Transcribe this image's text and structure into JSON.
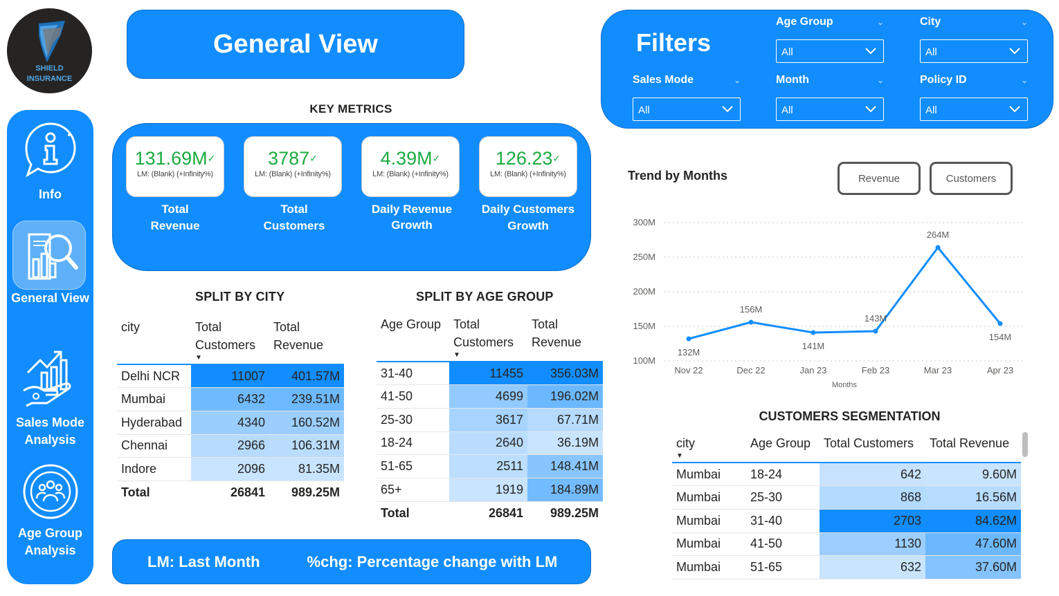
{
  "logo": {
    "line1": "SHIELD",
    "line2": "INSURANCE"
  },
  "nav": {
    "items": [
      {
        "label": "Info"
      },
      {
        "label": "General View"
      },
      {
        "label": "Sales Mode Analysis"
      },
      {
        "label": "Age Group Analysis"
      }
    ],
    "active": "General View"
  },
  "page_title": "General View",
  "filters": {
    "title": "Filters",
    "slicers": [
      {
        "label": "Age Group",
        "value": "All"
      },
      {
        "label": "City",
        "value": "All"
      },
      {
        "label": "Sales Mode",
        "value": "All"
      },
      {
        "label": "Month",
        "value": "All"
      },
      {
        "label": "Policy ID",
        "value": "All"
      }
    ]
  },
  "key_metrics": {
    "title": "KEY METRICS",
    "cards": [
      {
        "value": "131.69M",
        "check": "✓",
        "lm": "LM: (Blank) (+Infinity%)",
        "label1": "Total",
        "label2": "Revenue"
      },
      {
        "value": "3787",
        "check": "✓",
        "lm": "LM: (Blank) (+Infinity%)",
        "label1": "Total",
        "label2": "Customers"
      },
      {
        "value": "4.39M",
        "check": "✓",
        "lm": "LM: (Blank) (+Infinity%)",
        "label1": "Daily Revenue",
        "label2": "Growth"
      },
      {
        "value": "126.23",
        "check": "✓",
        "lm": "LM: (Blank) (+Infinity%)",
        "label1": "Daily Customers",
        "label2": "Growth"
      }
    ]
  },
  "split_city": {
    "title": "SPLIT BY CITY",
    "headers": [
      "city",
      "Total Customers",
      "Total Revenue"
    ],
    "rows": [
      {
        "city": "Delhi NCR",
        "customers": "11007",
        "revenue": "401.57M"
      },
      {
        "city": "Mumbai",
        "customers": "6432",
        "revenue": "239.51M"
      },
      {
        "city": "Hyderabad",
        "customers": "4340",
        "revenue": "160.52M"
      },
      {
        "city": "Chennai",
        "customers": "2966",
        "revenue": "106.31M"
      },
      {
        "city": "Indore",
        "customers": "2096",
        "revenue": "81.35M"
      }
    ],
    "total": {
      "label": "Total",
      "customers": "26841",
      "revenue": "989.25M"
    }
  },
  "split_age": {
    "title": "SPLIT BY AGE GROUP",
    "headers": [
      "Age Group",
      "Total Customers",
      "Total Revenue"
    ],
    "rows": [
      {
        "age": "31-40",
        "customers": "11455",
        "revenue": "356.03M"
      },
      {
        "age": "41-50",
        "customers": "4699",
        "revenue": "196.02M"
      },
      {
        "age": "25-30",
        "customers": "3617",
        "revenue": "67.71M"
      },
      {
        "age": "18-24",
        "customers": "2640",
        "revenue": "36.19M"
      },
      {
        "age": "51-65",
        "customers": "2511",
        "revenue": "148.41M"
      },
      {
        "age": "65+",
        "customers": "1919",
        "revenue": "184.89M"
      }
    ],
    "total": {
      "label": "Total",
      "customers": "26841",
      "revenue": "989.25M"
    }
  },
  "trend": {
    "title": "Trend by Months",
    "buttons": [
      "Revenue",
      "Customers"
    ]
  },
  "chart_data": {
    "type": "line",
    "categories": [
      "Nov 22",
      "Dec 22",
      "Jan 23",
      "Feb 23",
      "Mar 23",
      "Apr 23"
    ],
    "values": [
      132,
      156,
      141,
      143,
      264,
      154
    ],
    "data_labels": [
      "132M",
      "156M",
      "141M",
      "143M",
      "264M",
      "154M"
    ],
    "yticks": [
      "100M",
      "150M",
      "200M",
      "250M",
      "300M"
    ],
    "ylim": [
      100,
      300
    ],
    "xlabel": "Months",
    "ylabel": "",
    "grid": true,
    "color": "#118dff"
  },
  "segmentation": {
    "title": "CUSTOMERS SEGMENTATION",
    "headers": [
      "city",
      "Age Group",
      "Total Customers",
      "Total Revenue"
    ],
    "rows": [
      {
        "city": "Mumbai",
        "age": "18-24",
        "customers": "642",
        "revenue": "9.60M"
      },
      {
        "city": "Mumbai",
        "age": "25-30",
        "customers": "868",
        "revenue": "16.56M"
      },
      {
        "city": "Mumbai",
        "age": "31-40",
        "customers": "2703",
        "revenue": "84.62M"
      },
      {
        "city": "Mumbai",
        "age": "41-50",
        "customers": "1130",
        "revenue": "47.60M"
      },
      {
        "city": "Mumbai",
        "age": "51-65",
        "customers": "632",
        "revenue": "37.60M"
      }
    ]
  },
  "footer": {
    "lm": "LM: Last Month",
    "chg": "%chg: Percentage change with LM"
  },
  "colors": {
    "accent": "#118dff",
    "positive": "#1aab40"
  }
}
